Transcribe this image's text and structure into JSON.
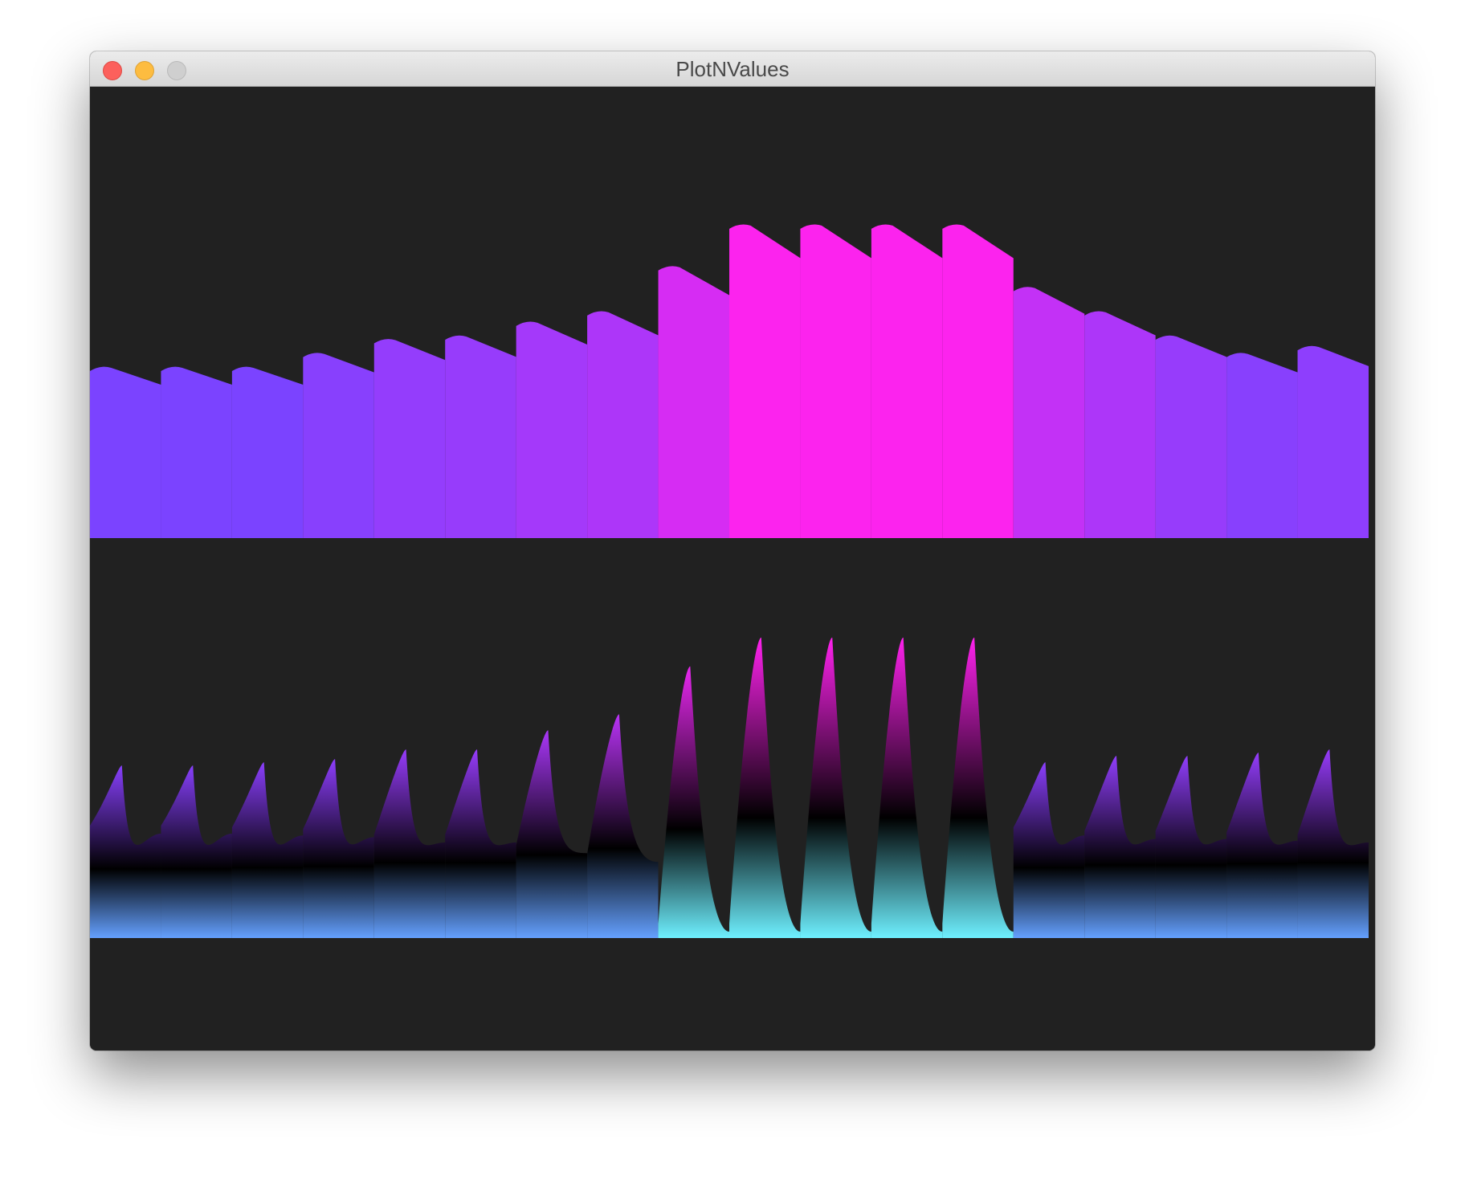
{
  "window": {
    "title": "PlotNValues"
  },
  "colors": {
    "background": "#212121",
    "purple": "#7b43ff",
    "magenta": "#ff22ee",
    "blue": "#5a50ff",
    "cyan": "#6ef0ff"
  },
  "chart_data": [
    {
      "type": "area",
      "x": [
        0,
        1,
        2,
        3,
        4,
        5,
        6,
        7,
        8,
        9,
        10,
        11,
        12,
        13,
        14,
        15,
        16,
        17
      ],
      "values": [
        0.5,
        0.5,
        0.5,
        0.54,
        0.58,
        0.59,
        0.63,
        0.66,
        0.79,
        0.91,
        0.91,
        0.91,
        0.91,
        0.73,
        0.66,
        0.59,
        0.54,
        0.56
      ],
      "ylim": [
        0,
        1
      ]
    },
    {
      "type": "area",
      "x": [
        0,
        1,
        2,
        3,
        4,
        5,
        6,
        7,
        8,
        9,
        10,
        11,
        12,
        13,
        14,
        15,
        16,
        17
      ],
      "values": [
        0.54,
        0.54,
        0.55,
        0.56,
        0.59,
        0.59,
        0.65,
        0.7,
        0.85,
        0.94,
        0.94,
        0.94,
        0.94,
        0.55,
        0.57,
        0.57,
        0.58,
        0.59
      ],
      "ylim": [
        0,
        1
      ]
    }
  ]
}
